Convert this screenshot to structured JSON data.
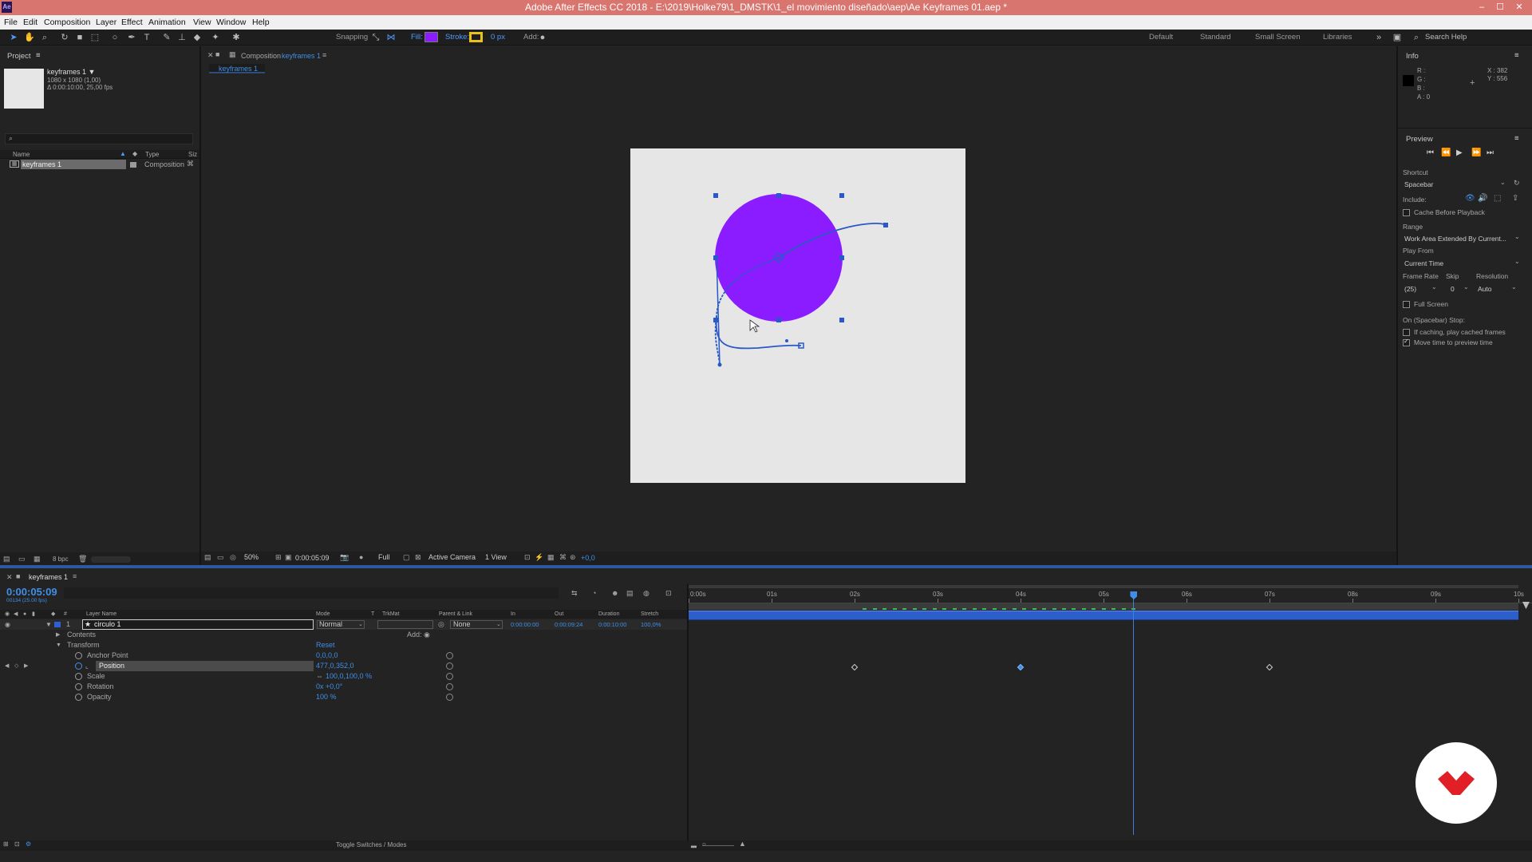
{
  "app": {
    "icon_label": "Ae",
    "title": "Adobe After Effects CC 2018 - E:\\2019\\Holke79\\1_DMSTK\\1_el movimiento diseñado\\aep\\Ae Keyframes 01.aep *"
  },
  "menu": [
    "File",
    "Edit",
    "Composition",
    "Layer",
    "Effect",
    "Animation",
    "View",
    "Window",
    "Help"
  ],
  "toolbar": {
    "snapping_label": "Snapping",
    "fill_label": "Fill:",
    "fill_color": "#8a1cff",
    "stroke_label": "Stroke:",
    "stroke_color": "#e8c21a",
    "stroke_width": "0 px",
    "add_label": "Add:",
    "workspaces": [
      "Default",
      "Standard",
      "Small Screen",
      "Libraries"
    ],
    "search_placeholder": "Search Help"
  },
  "project": {
    "panel_title": "Project",
    "item_name": "keyframes 1 ▼",
    "item_info1": "1080 x 1080 (1,00)",
    "item_info2": "Δ 0:00:10:00, 25,00 fps",
    "col_name": "Name",
    "col_type": "Type",
    "col_size": "Siz",
    "row_name": "keyframes 1",
    "row_type": "Composition",
    "bpc": "8 bpc"
  },
  "composition": {
    "tab_prefix": "Composition",
    "tab_name": "keyframes 1",
    "subtab": "keyframes 1",
    "zoom": "50%",
    "timecode": "0:00:05:09",
    "resolution": "Full",
    "camera": "Active Camera",
    "views": "1 View",
    "exposure": "+0,0",
    "circle_color": "#8a1cff"
  },
  "info": {
    "panel_title": "Info",
    "r": "R :",
    "g": "G :",
    "b": "B :",
    "a": "A : 0",
    "x": "X : 382",
    "y": "Y : 556"
  },
  "preview": {
    "panel_title": "Preview",
    "shortcut_label": "Shortcut",
    "shortcut_value": "Spacebar",
    "include_label": "Include:",
    "cache_label": "Cache Before Playback",
    "range_label": "Range",
    "range_value": "Work Area Extended By Current...",
    "play_from_label": "Play From",
    "play_from_value": "Current Time",
    "frame_rate_label": "Frame Rate",
    "skip_label": "Skip",
    "resolution_label": "Resolution",
    "frame_rate_value": "(25)",
    "skip_value": "0",
    "resolution_value": "Auto",
    "full_screen_label": "Full Screen",
    "stop_label": "On (Spacebar) Stop:",
    "if_caching_label": "If caching, play cached frames",
    "move_time_label": "Move time to preview time"
  },
  "timeline": {
    "tab_name": "keyframes 1",
    "timecode": "0:00:05:09",
    "timecode_sub": "00134 (25.00 fps)",
    "headers": {
      "layer_name": "Layer Name",
      "mode": "Mode",
      "t": "T",
      "trkmat": "TrkMat",
      "parent": "Parent & Link",
      "in": "In",
      "out": "Out",
      "duration": "Duration",
      "stretch": "Stretch"
    },
    "layer": {
      "number": "1",
      "name": "circulo 1",
      "mode": "Normal",
      "parent": "None",
      "in": "0:00:00:00",
      "out": "0:00:09:24",
      "duration": "0:00:10:00",
      "stretch": "100,0%"
    },
    "contents_label": "Contents",
    "add_label": "Add:",
    "transform_label": "Transform",
    "reset_label": "Reset",
    "properties": [
      {
        "name": "Anchor Point",
        "value": "0,0,0,0"
      },
      {
        "name": "Position",
        "value": "477,0,352,0"
      },
      {
        "name": "Scale",
        "value": "100,0,100,0 %"
      },
      {
        "name": "Rotation",
        "value": "0x +0,0°"
      },
      {
        "name": "Opacity",
        "value": "100 %"
      }
    ],
    "ruler": [
      "0:00s",
      "01s",
      "02s",
      "03s",
      "04s",
      "05s",
      "06s",
      "07s",
      "08s",
      "09s",
      "10s"
    ],
    "current_time_seconds": 5.36,
    "position_keyframes_seconds": [
      2.0,
      4.0,
      7.0
    ],
    "toggle_label": "Toggle Switches / Modes"
  },
  "logo": {
    "color": "#e01f26"
  }
}
